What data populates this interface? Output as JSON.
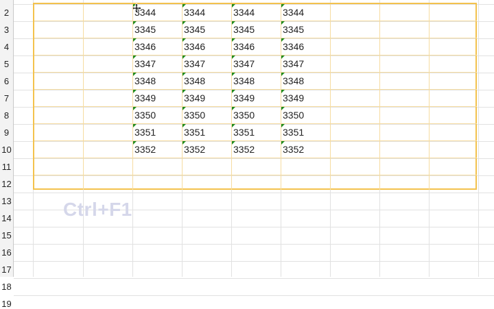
{
  "row_numbers": [
    "2",
    "3",
    "4",
    "5",
    "6",
    "7",
    "8",
    "9",
    "10",
    "11",
    "12",
    "13",
    "14",
    "15",
    "16",
    "17",
    "18",
    "19"
  ],
  "table": {
    "rows": [
      [
        "3344",
        "3344",
        "3344",
        "3344"
      ],
      [
        "3345",
        "3345",
        "3345",
        "3345"
      ],
      [
        "3346",
        "3346",
        "3346",
        "3346"
      ],
      [
        "3347",
        "3347",
        "3347",
        "3347"
      ],
      [
        "3348",
        "3348",
        "3348",
        "3348"
      ],
      [
        "3349",
        "3349",
        "3349",
        "3349"
      ],
      [
        "3350",
        "3350",
        "3350",
        "3350"
      ],
      [
        "3351",
        "3351",
        "3351",
        "3351"
      ],
      [
        "3352",
        "3352",
        "3352",
        "3352"
      ]
    ]
  },
  "shortcut_hint": "Ctrl+F1",
  "colors": {
    "selection_border": "#f3c24d",
    "error_indicator": "#1e8b1e",
    "hint_text": "#d5d7ea"
  },
  "icons": {
    "cursor": "move-cursor-icon",
    "cell_marker": "number-as-text-indicator-icon"
  }
}
